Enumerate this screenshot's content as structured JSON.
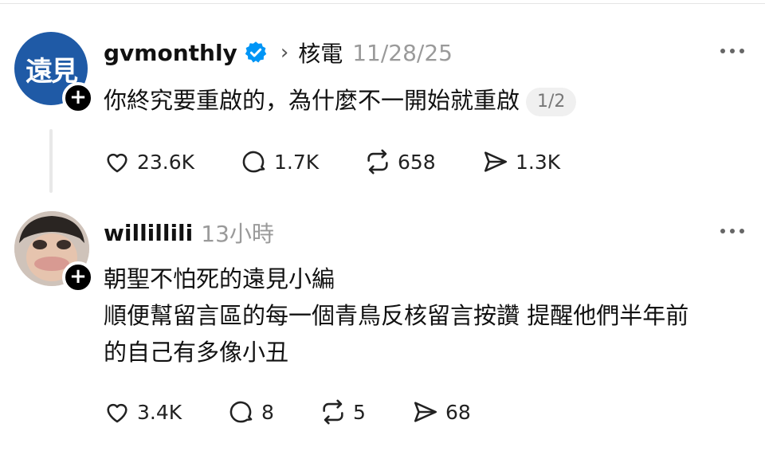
{
  "post": {
    "username": "gvmonthly",
    "topic": "核電",
    "time": "11/28/25",
    "avatar_text": "遠見",
    "text": "你終究要重啟的，為什麼不一開始就重啟",
    "page": "1/2",
    "likes": "23.6K",
    "comments": "1.7K",
    "reposts": "658",
    "shares": "1.3K"
  },
  "reply": {
    "username": "willillili",
    "time": "13小時",
    "lines": [
      "朝聖不怕死的遠見小編",
      "順便幫留言區的每一個青鳥反核留言按讚 提醒他們半年前",
      "的自己有多像小丑"
    ],
    "likes": "3.4K",
    "comments": "8",
    "reposts": "5",
    "shares": "68"
  },
  "icons": {
    "verified": "verified-badge-icon",
    "chevron": "chevron-right-icon",
    "like": "heart-icon",
    "comment": "comment-bubble-icon",
    "repost": "repost-icon",
    "share": "send-icon",
    "follow": "plus-icon",
    "more": "more-dots-icon"
  },
  "colors": {
    "verified": "#0095f6",
    "brand": "#1f5aa6",
    "muted": "#9a9a9a"
  }
}
